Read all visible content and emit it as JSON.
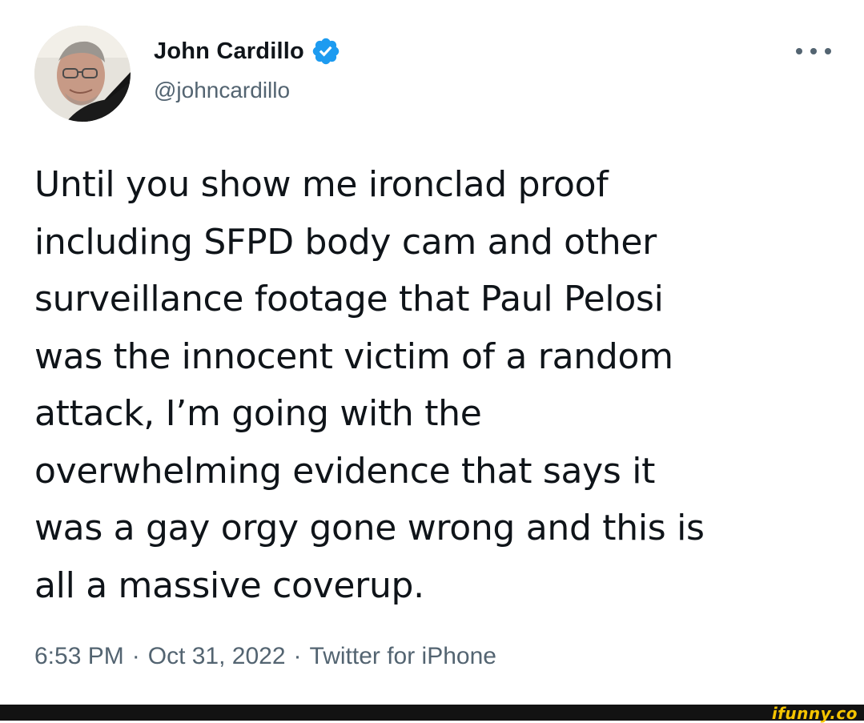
{
  "tweet": {
    "author": {
      "display_name": "John Cardillo",
      "handle": "@johncardillo",
      "verified": true
    },
    "text_lines": [
      "Until you show me ironclad proof",
      "including SFPD body cam and other",
      "surveillance footage that Paul Pelosi",
      "was the innocent victim of a random",
      "attack, I’m going with the",
      "overwhelming evidence that says it",
      "was a gay orgy gone wrong and this is",
      "all a massive coverup."
    ],
    "time": "6:53 PM",
    "separator": "·",
    "date": "Oct 31, 2022",
    "source": "Twitter for iPhone"
  },
  "icons": {
    "verified": "verified-badge-icon",
    "more": "more-options-icon"
  },
  "colors": {
    "verified_blue": "#1d9bf0",
    "text": "#0f1419",
    "secondary_text": "#536471",
    "footer_bar": "#121212",
    "watermark": "#f5c400"
  },
  "watermark": {
    "text": "ifunny.co"
  }
}
